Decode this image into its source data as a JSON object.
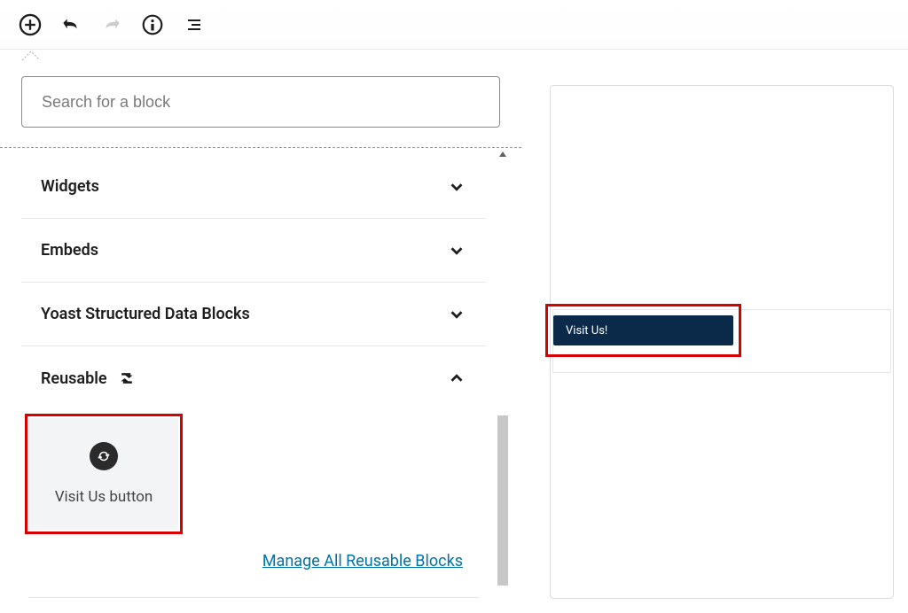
{
  "search": {
    "placeholder": "Search for a block"
  },
  "categories": [
    {
      "name": "Widgets",
      "expanded": false
    },
    {
      "name": "Embeds",
      "expanded": false
    },
    {
      "name": "Yoast Structured Data Blocks",
      "expanded": false
    },
    {
      "name": "Reusable",
      "expanded": true
    }
  ],
  "reusable": {
    "block_name": "Visit Us button",
    "manage_link": "Manage All Reusable Blocks"
  },
  "preview": {
    "button_text": "Visit Us!"
  }
}
